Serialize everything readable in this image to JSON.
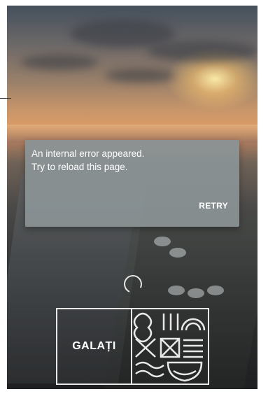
{
  "dialog": {
    "line1": "An internal error appeared.",
    "line2": "Try to reload this page.",
    "retry_label": "RETRY"
  },
  "logo": {
    "text": "GALAȚI"
  },
  "icons": [
    "loading-spinner-icon",
    "city-emblem-icon"
  ],
  "colors": {
    "dialog_bg": "#8b9496",
    "text": "#ffffff"
  }
}
